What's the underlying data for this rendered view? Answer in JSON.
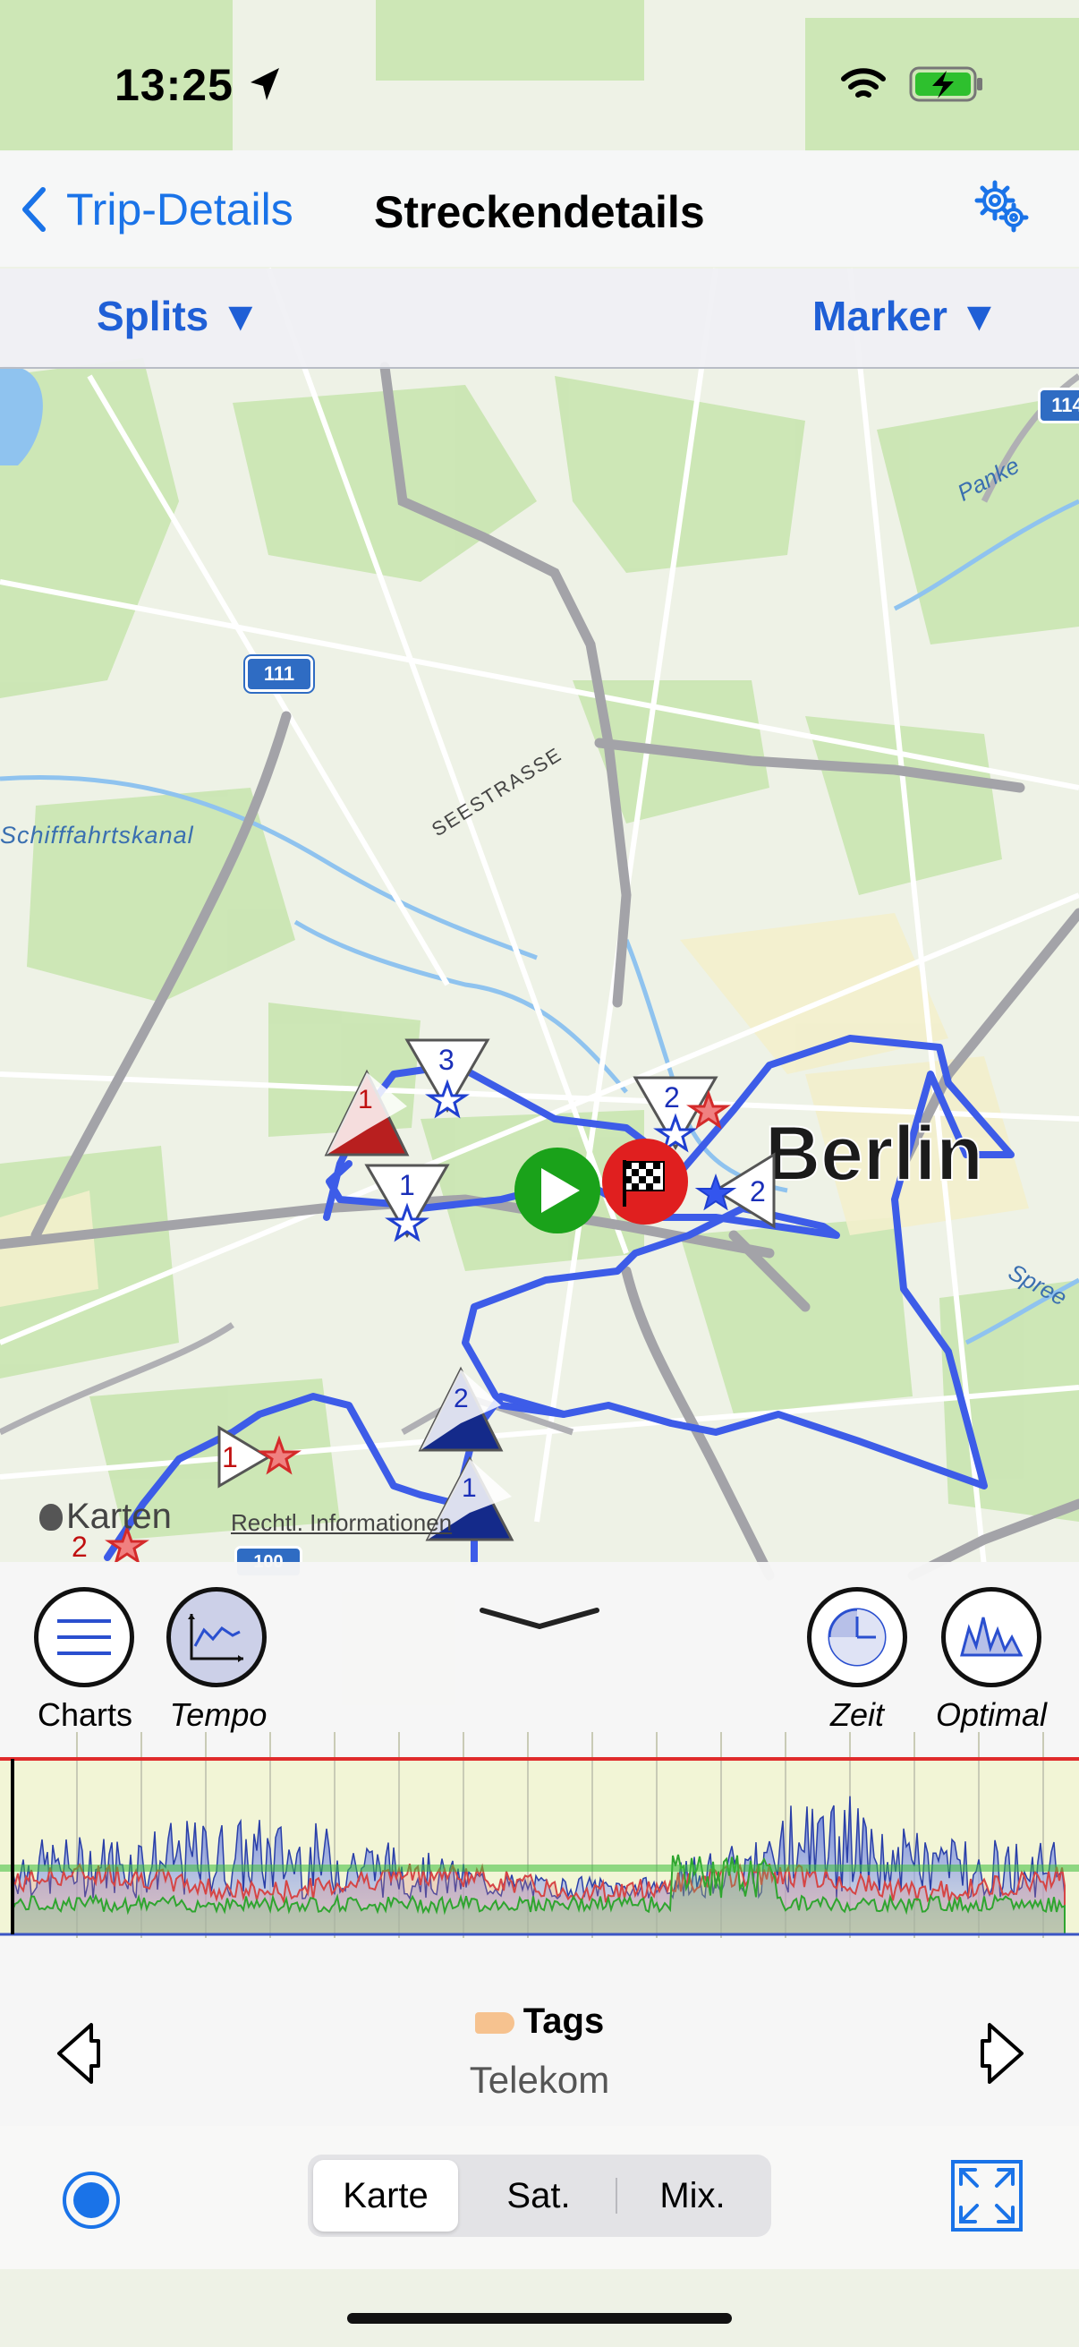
{
  "status_bar": {
    "time": "13:25"
  },
  "nav": {
    "back_label": "Trip-Details",
    "title": "Streckendetails"
  },
  "segment_bar": {
    "left_label": "Splits ▼",
    "right_label": "Marker ▼"
  },
  "map": {
    "city_label": "Berlin",
    "road_labels": {
      "seestrasse": "SEESTRASSE",
      "canal": "Schifffahrtskanal",
      "panke": "Panke",
      "spree": "Spree"
    },
    "route_shields": {
      "a111": "111",
      "a114": "114",
      "a100": "100"
    },
    "attribution": {
      "maps": "Karten",
      "legal": "Rechtl. Informationen"
    },
    "markers": {
      "red_tri_1": "1",
      "white_tri_3": "3",
      "white_tri_1": "1",
      "white_tri_2a": "2",
      "white_tri_2b": "2",
      "blue_tri_2": "2",
      "blue_tri_1": "1",
      "white_tri_1b": "1",
      "red_2": "2"
    }
  },
  "panel": {
    "buttons": [
      {
        "label": "Charts"
      },
      {
        "label": "Tempo"
      },
      {
        "label": "Zeit"
      },
      {
        "label": "Optimal"
      }
    ],
    "tags_title": "Tags",
    "tags_value": "Telekom"
  },
  "view_mode": {
    "options": [
      "Karte",
      "Sat.",
      "Mix."
    ],
    "selected": "Karte"
  },
  "colors": {
    "accent": "#1a73e8",
    "route": "#3d5ce8",
    "start_green": "#1aa21a",
    "finish_red": "#e01f1f",
    "chart_blue": "#3b55c4",
    "chart_red": "#d64545",
    "chart_green": "#2fa52f"
  }
}
